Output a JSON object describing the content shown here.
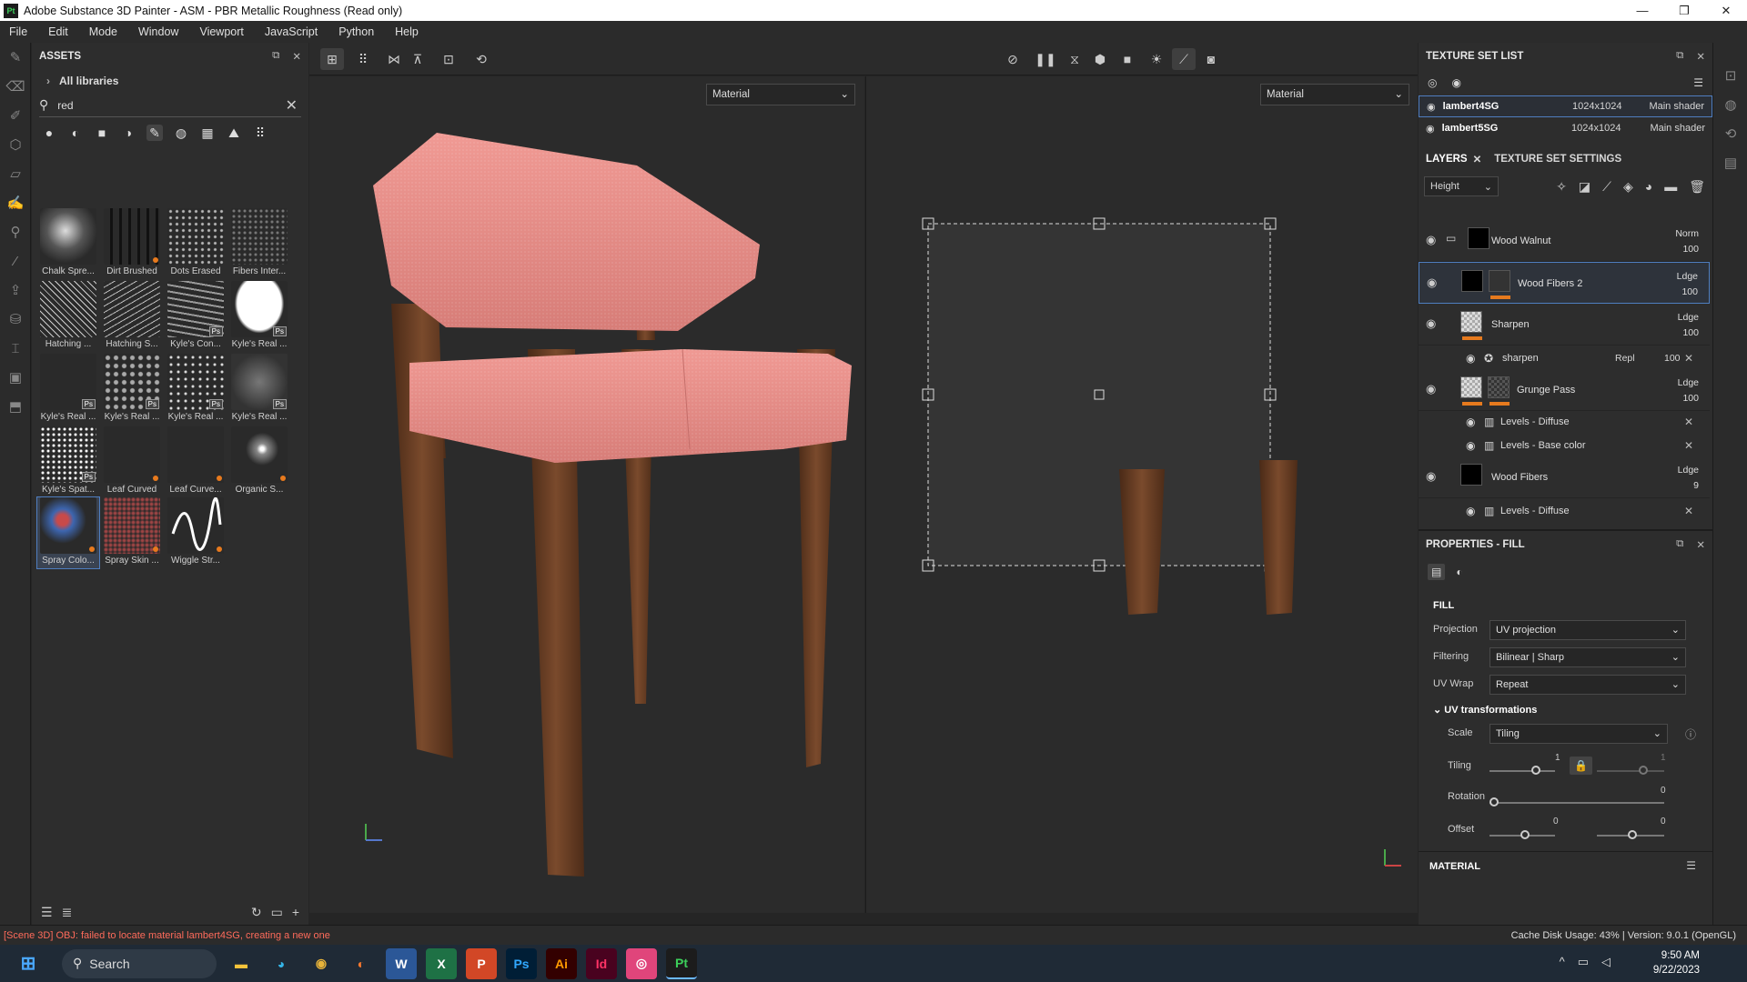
{
  "window": {
    "title": "Adobe Substance 3D Painter - ASM - PBR Metallic Roughness (Read only)",
    "app_badge": "Pt"
  },
  "menu": [
    "File",
    "Edit",
    "Mode",
    "Window",
    "Viewport",
    "JavaScript",
    "Python",
    "Help"
  ],
  "assets": {
    "title": "ASSETS",
    "library": "All libraries",
    "search_value": "red",
    "items": [
      "Chalk Spre...",
      "Dirt Brushed",
      "Dots Erased",
      "Fibers Inter...",
      "Hatching ...",
      "Hatching S...",
      "Kyle's Con...",
      "Kyle's Real ...",
      "Kyle's Real ...",
      "Kyle's Real ...",
      "Kyle's Real ...",
      "Kyle's Real ...",
      "Kyle's Spat...",
      "Leaf Curved",
      "Leaf Curve...",
      "Organic S...",
      "Spray Colo...",
      "Spray Skin ...",
      "Wiggle Str..."
    ],
    "ps_badge": "Ps"
  },
  "viewport": {
    "left_mode": "Material",
    "right_mode": "Material"
  },
  "texture_set_list": {
    "title": "TEXTURE SET LIST",
    "rows": [
      {
        "name": "lambert4SG",
        "res": "1024x1024",
        "shader": "Main shader"
      },
      {
        "name": "lambert5SG",
        "res": "1024x1024",
        "shader": "Main shader"
      }
    ]
  },
  "layers": {
    "tab_layers": "LAYERS",
    "tab_settings": "TEXTURE SET SETTINGS",
    "channel": "Height",
    "items": [
      {
        "name": "Wood Walnut",
        "blend": "Norm",
        "opacity": "100"
      },
      {
        "name": "Wood Fibers 2",
        "blend": "Ldge",
        "opacity": "100"
      },
      {
        "name": "Sharpen",
        "blend": "Ldge",
        "opacity": "100"
      },
      {
        "name": "Grunge Pass",
        "blend": "Ldge",
        "opacity": "100"
      },
      {
        "name": "Wood Fibers",
        "blend": "Ldge",
        "opacity": "9"
      }
    ],
    "sub": {
      "sharpen": "sharpen",
      "sharpen_blend": "Repl",
      "sharpen_opacity": "100",
      "levels_diffuse": "Levels - Diffuse",
      "levels_base": "Levels - Base color",
      "levels_diffuse2": "Levels - Diffuse"
    }
  },
  "properties": {
    "title": "PROPERTIES - FILL",
    "section": "FILL",
    "projection_label": "Projection",
    "projection": "UV projection",
    "filtering_label": "Filtering",
    "filtering": "Bilinear | Sharp",
    "uvwrap_label": "UV Wrap",
    "uvwrap": "Repeat",
    "uvt": "UV transformations",
    "scale_label": "Scale",
    "scale": "Tiling",
    "tiling_label": "Tiling",
    "tiling_u": "1",
    "tiling_v": "1",
    "rotation_label": "Rotation",
    "rotation": "0",
    "offset_label": "Offset",
    "offset_u": "0",
    "offset_v": "0",
    "material": "MATERIAL"
  },
  "status": {
    "error": "[Scene 3D] OBJ: failed to locate material lambert4SG, creating a new one",
    "cache": "Cache Disk Usage:   43% | Version: 9.0.1 (OpenGL)"
  },
  "taskbar": {
    "search": "Search",
    "time": "9:50 AM",
    "date": "9/22/2023"
  },
  "colors": {
    "accent_orange": "#e67a1e",
    "selection_blue": "#4f7ec0",
    "seat_pink": "#e88c88",
    "wood_brown": "#6b3d22",
    "error_red": "#ff6b5b"
  }
}
